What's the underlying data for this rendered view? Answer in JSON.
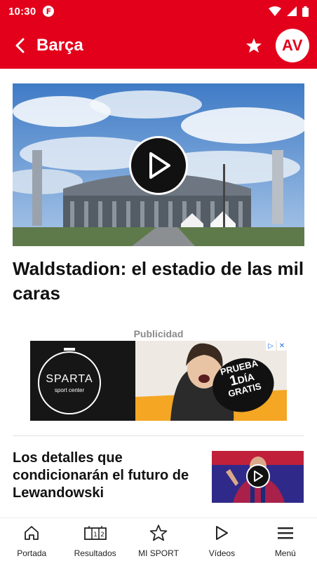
{
  "status_bar": {
    "time": "10:30",
    "app_badge": "F"
  },
  "app_bar": {
    "title": "Barça",
    "avatar_initials": "AV"
  },
  "lead_article": {
    "headline": "Waldstadion: el estadio de las mil caras"
  },
  "ad": {
    "label": "Publicidad",
    "brand_name": "SPARTA",
    "brand_sub": "sport center",
    "promo_line1": "PRUEBA",
    "promo_line2": "1",
    "promo_line2b": "DÍA",
    "promo_line3": "GRATIS"
  },
  "second_article": {
    "headline": "Los detalles que condicionarán el futuro de Lewandowski"
  },
  "bottom_nav": [
    {
      "label": "Portada",
      "icon": "home-icon"
    },
    {
      "label": "Resultados",
      "icon": "scoreboard-icon"
    },
    {
      "label": "MI SPORT",
      "icon": "star-outline-icon"
    },
    {
      "label": "Vídeos",
      "icon": "play-icon"
    },
    {
      "label": "Menú",
      "icon": "menu-icon"
    }
  ],
  "colors": {
    "brand_red": "#e3001b",
    "ad_orange": "#f5a623"
  }
}
